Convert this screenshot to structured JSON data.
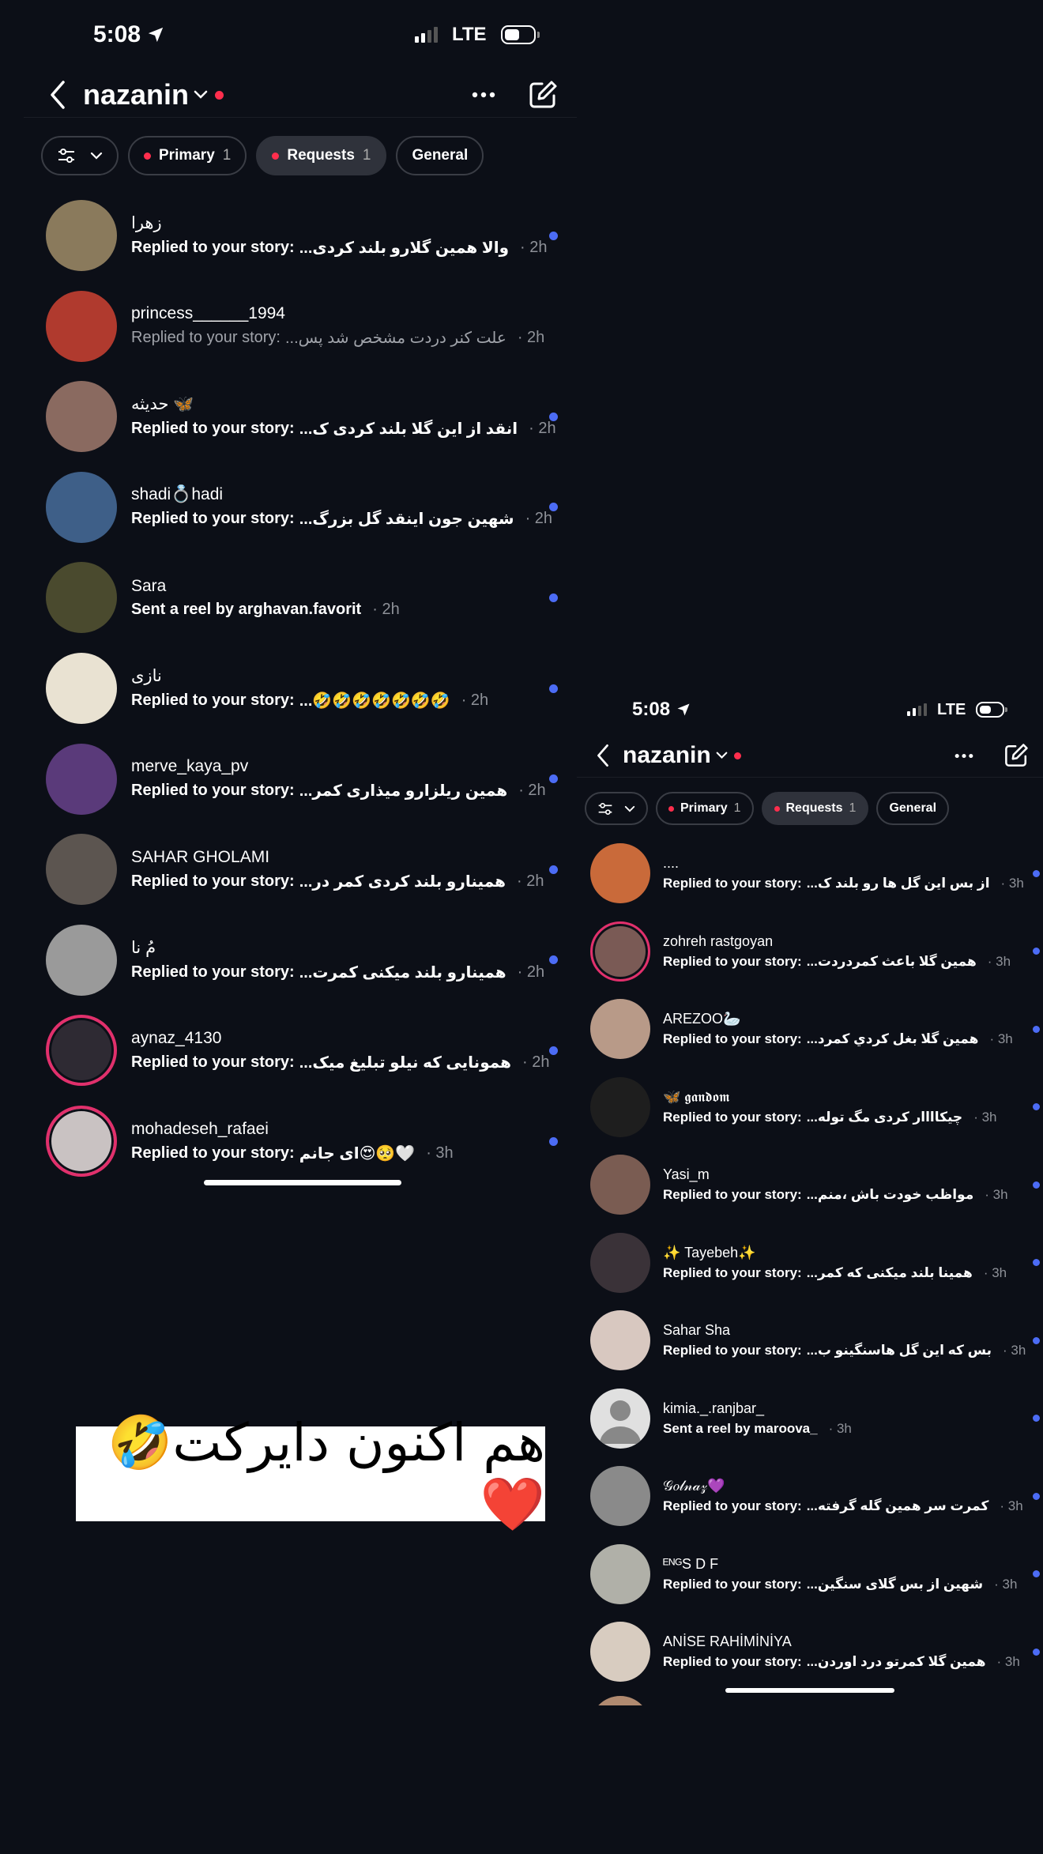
{
  "left": {
    "status": {
      "time": "5:08",
      "network": "LTE"
    },
    "header": {
      "title": "nazanin"
    },
    "tabs": [
      {
        "label": "Primary",
        "count": "1",
        "dot": true,
        "active": false
      },
      {
        "label": "Requests",
        "count": "1",
        "dot": true,
        "active": true
      },
      {
        "label": "General",
        "count": "",
        "dot": false,
        "active": false
      }
    ],
    "rows": [
      {
        "name": "زهرا",
        "prefix": "Replied to your story:",
        "msg": "والا همین گلارو بلند کردی...",
        "time": "· 2h",
        "unread": true,
        "bg": "#8a7a5c"
      },
      {
        "name": "princess______1994",
        "prefix": "Replied to your story:",
        "msg": "علت کنر دردت مشخص شد پس...",
        "time": "· 2h",
        "unread": false,
        "bg": "#b03a2e"
      },
      {
        "name": "حدیثه 🦋",
        "prefix": "Replied to your story:",
        "msg": "انقد از این گلا بلند کردی ک...",
        "time": "· 2h",
        "unread": true,
        "bg": "#8a6a60"
      },
      {
        "name": "shadi💍hadi",
        "prefix": "Replied to your story:",
        "msg": "شهین جون اینقد گل بزرگ...",
        "time": "· 2h",
        "unread": true,
        "bg": "#3e5f88"
      },
      {
        "name": "Sara",
        "prefix": "Sent a reel by arghavan.favorit",
        "msg": "",
        "time": "· 2h",
        "unread": true,
        "bg": "#4a4a2e"
      },
      {
        "name": "نازی",
        "prefix": "Replied to your story:",
        "msg": "🤣🤣🤣🤣🤣🤣🤣...",
        "time": "· 2h",
        "unread": true,
        "bg": "#e9e2d2"
      },
      {
        "name": "merve_kaya_pv",
        "prefix": "Replied to your story:",
        "msg": "همین ریلزارو میذاری کمر...",
        "time": "· 2h",
        "unread": true,
        "bg": "#5a3a7a"
      },
      {
        "name": "SAHAR GHOLAMI",
        "prefix": "Replied to your story:",
        "msg": "همینارو بلند کردی کمر در...",
        "time": "· 2h",
        "unread": true,
        "bg": "#5c5550"
      },
      {
        "name": "مُ نا",
        "prefix": "Replied to your story:",
        "msg": "همینارو بلند میکنی کمرت...",
        "time": "· 2h",
        "unread": true,
        "bg": "#9a9a9a"
      },
      {
        "name": "aynaz_4130",
        "prefix": "Replied to your story:",
        "msg": "همونایی که نیلو تبلیغ میک...",
        "time": "· 2h",
        "unread": true,
        "bg": "#2e2a33",
        "ring": true
      },
      {
        "name": "mohadeseh_rafaei",
        "prefix": "Replied to your story:",
        "msg": "🤍🥺😍ای جانم",
        "time": "· 3h",
        "unread": true,
        "bg": "#c9c2c2",
        "ring": true
      }
    ]
  },
  "caption": "هم اکنون دایرکت🤣❤️",
  "right": {
    "status": {
      "time": "5:08",
      "network": "LTE"
    },
    "header": {
      "title": "nazanin"
    },
    "tabs": [
      {
        "label": "Primary",
        "count": "1",
        "dot": true,
        "active": false
      },
      {
        "label": "Requests",
        "count": "1",
        "dot": true,
        "active": true
      },
      {
        "label": "General",
        "count": "",
        "dot": false,
        "active": false
      }
    ],
    "rows": [
      {
        "name": "....",
        "prefix": "Replied to your story:",
        "msg": "از بس این گل ها رو بلند ک...",
        "time": "· 3h",
        "unread": true,
        "bg": "#c96a3a"
      },
      {
        "name": "zohreh rastgoyan",
        "prefix": "Replied to your story:",
        "msg": "همین گلا باعث کمردردت...",
        "time": "· 3h",
        "unread": true,
        "bg": "#7a5a55",
        "ring": true
      },
      {
        "name": "AREZOO🦢",
        "prefix": "Replied to your story:",
        "msg": "همین گلا بغل كردي كمرد...",
        "time": "· 3h",
        "unread": true,
        "bg": "#b89a88"
      },
      {
        "name": "🦋 𝖌𝖆𝖓𝖉𝖔𝖒",
        "prefix": "Replied to your story:",
        "msg": "چیکاااار کردی مگ توله...",
        "time": "· 3h",
        "unread": true,
        "bg": "#1e1e1e"
      },
      {
        "name": "Yasi_m",
        "prefix": "Replied to your story:",
        "msg": "مواظب خودت باش ،منم...",
        "time": "· 3h",
        "unread": true,
        "bg": "#7a5c52"
      },
      {
        "name": "✨ Tayebeh✨",
        "prefix": "Replied to your story:",
        "msg": "همینا بلند میکنی که کمر...",
        "time": "· 3h",
        "unread": true,
        "bg": "#3a3238"
      },
      {
        "name": "Sahar Sha",
        "prefix": "Replied to your story:",
        "msg": "بس که این گل هاسنگینو ب...",
        "time": "· 3h",
        "unread": true,
        "bg": "#d8c8c0"
      },
      {
        "name": "kimia._.ranjbar_",
        "prefix": "Sent a reel by maroova_",
        "msg": "",
        "time": "· 3h",
        "unread": true,
        "bg": "#e0e0e0",
        "placeholder": true
      },
      {
        "name": "𝒢𝑜𝓁𝓃𝒶𝓏💜",
        "prefix": "Replied to your story:",
        "msg": "کمرت سر همین گله گرفته...",
        "time": "· 3h",
        "unread": true,
        "bg": "#8a8a8a"
      },
      {
        "name": "ᴱᴺᴳS D F",
        "prefix": "Replied to your story:",
        "msg": "شهین از بس گلای سنگین...",
        "time": "· 3h",
        "unread": true,
        "bg": "#b0b0a8"
      },
      {
        "name": "ANİSE RAHİMİNİYA",
        "prefix": "Replied to your story:",
        "msg": "همین گلا کمرتو درد اوردن...",
        "time": "· 3h",
        "unread": true,
        "bg": "#d8ccc0"
      }
    ]
  }
}
